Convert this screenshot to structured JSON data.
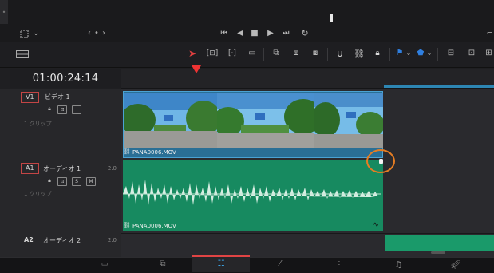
{
  "viewer": {
    "timecode": "01:00:24:14"
  },
  "tracks": [
    {
      "id": "V1",
      "name": "ビデオ 1",
      "clips_text": "1 クリップ",
      "level": ""
    },
    {
      "id": "A1",
      "name": "オーディオ 1",
      "clips_text": "1 クリップ",
      "level": "2.0"
    },
    {
      "id": "A2",
      "name": "オーディオ 2",
      "clips_text": "",
      "level": "2.0"
    }
  ],
  "buttons": {
    "s": "S",
    "m": "M"
  },
  "clips": {
    "video_label": "PANA0006.MOV",
    "audio_label": "PANA0006.MOV"
  },
  "colors": {
    "accent_red": "#e04040",
    "video_clip": "#2a6f95",
    "audio_clip": "#178a60",
    "highlight_circle": "#e57d23"
  },
  "icons": [
    "view-options-icon",
    "transport-prev-icon",
    "stop-icon",
    "play-icon",
    "next-icon",
    "loop-icon",
    "pointer-icon",
    "trim-icon",
    "blade-icon",
    "snap-icon",
    "link-icon",
    "lock-icon",
    "flag-icon",
    "marker-icon",
    "zoom-icon",
    "media-page-icon",
    "cut-page-icon",
    "edit-page-icon",
    "fusion-page-icon",
    "color-page-icon",
    "fairlight-page-icon",
    "deliver-page-icon"
  ]
}
